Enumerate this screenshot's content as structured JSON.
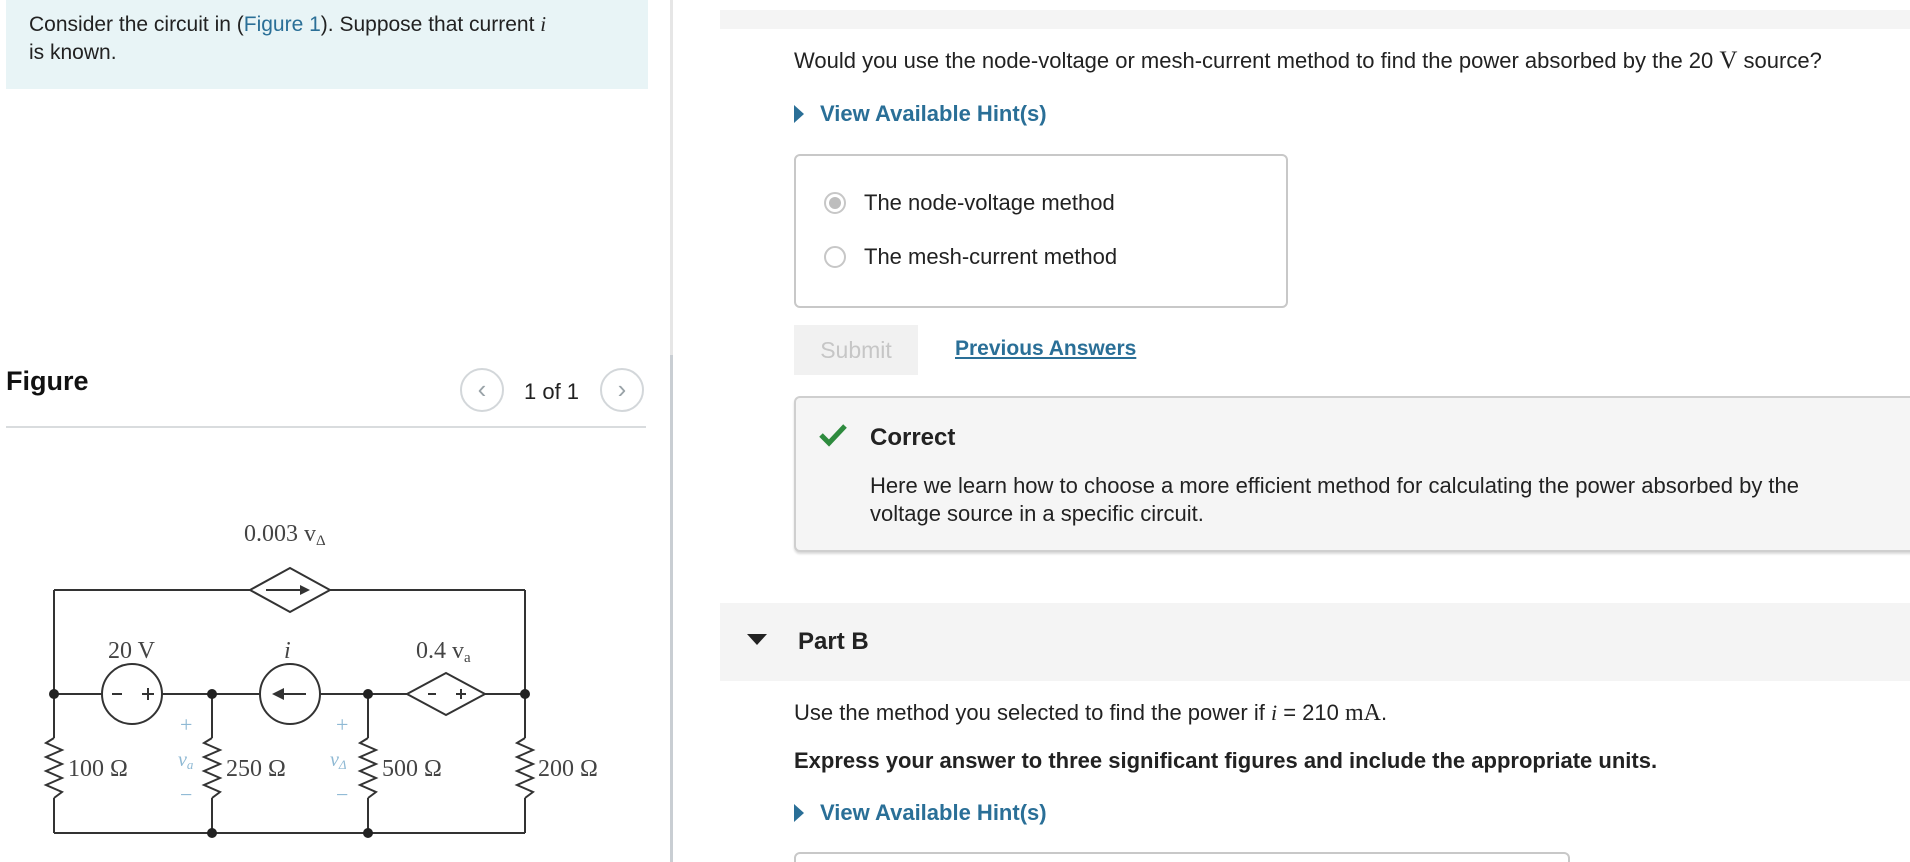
{
  "left": {
    "intro_pre": "Consider the circuit in (",
    "intro_link": "Figure 1",
    "intro_post": "). Suppose that current ",
    "intro_var": "i",
    "intro_line2": "is known.",
    "figure_title": "Figure",
    "pager_text": "1 of 1",
    "circuit": {
      "dep_current_label": "0.003 v",
      "dep_current_sub": "Δ",
      "vsource_label": "20 V",
      "isource_label": "i",
      "dep_voltage_label": "0.4 v",
      "dep_voltage_sub": "a",
      "r1": "100 Ω",
      "r2": "250 Ω",
      "r3": "500 Ω",
      "r4": "200 Ω",
      "va": "v",
      "va_sub": "a",
      "vdelta": "v",
      "vdelta_sub": "Δ",
      "plus": "+",
      "minus": "−"
    }
  },
  "partA": {
    "question_pre": "Would you use the node-voltage or mesh-current method to find the power absorbed by the 20 ",
    "question_unit": "V",
    "question_post": " source?",
    "hint_label": "View Available Hint(s)",
    "options": [
      {
        "label": "The node-voltage method",
        "selected": true
      },
      {
        "label": "The mesh-current method",
        "selected": false
      }
    ],
    "submit_label": "Submit",
    "previous_answers_label": "Previous Answers",
    "feedback_title": "Correct",
    "feedback_text": "Here we learn how to choose a more efficient method for calculating the power absorbed by the voltage source in a specific circuit."
  },
  "partB": {
    "title": "Part B",
    "question_pre": "Use the method you selected to find the power if ",
    "question_var": "i",
    "question_mid": " = 210 ",
    "question_unit": "mA",
    "question_post": ".",
    "instruction": "Express your answer to three significant figures and include the appropriate units.",
    "hint_label": "View Available Hint(s)"
  },
  "colors": {
    "link": "#2a6f97",
    "correct_green": "#2e8b3e",
    "intro_bg": "#e8f4f6",
    "circuit_plus_minus": "#8fb9d4"
  }
}
